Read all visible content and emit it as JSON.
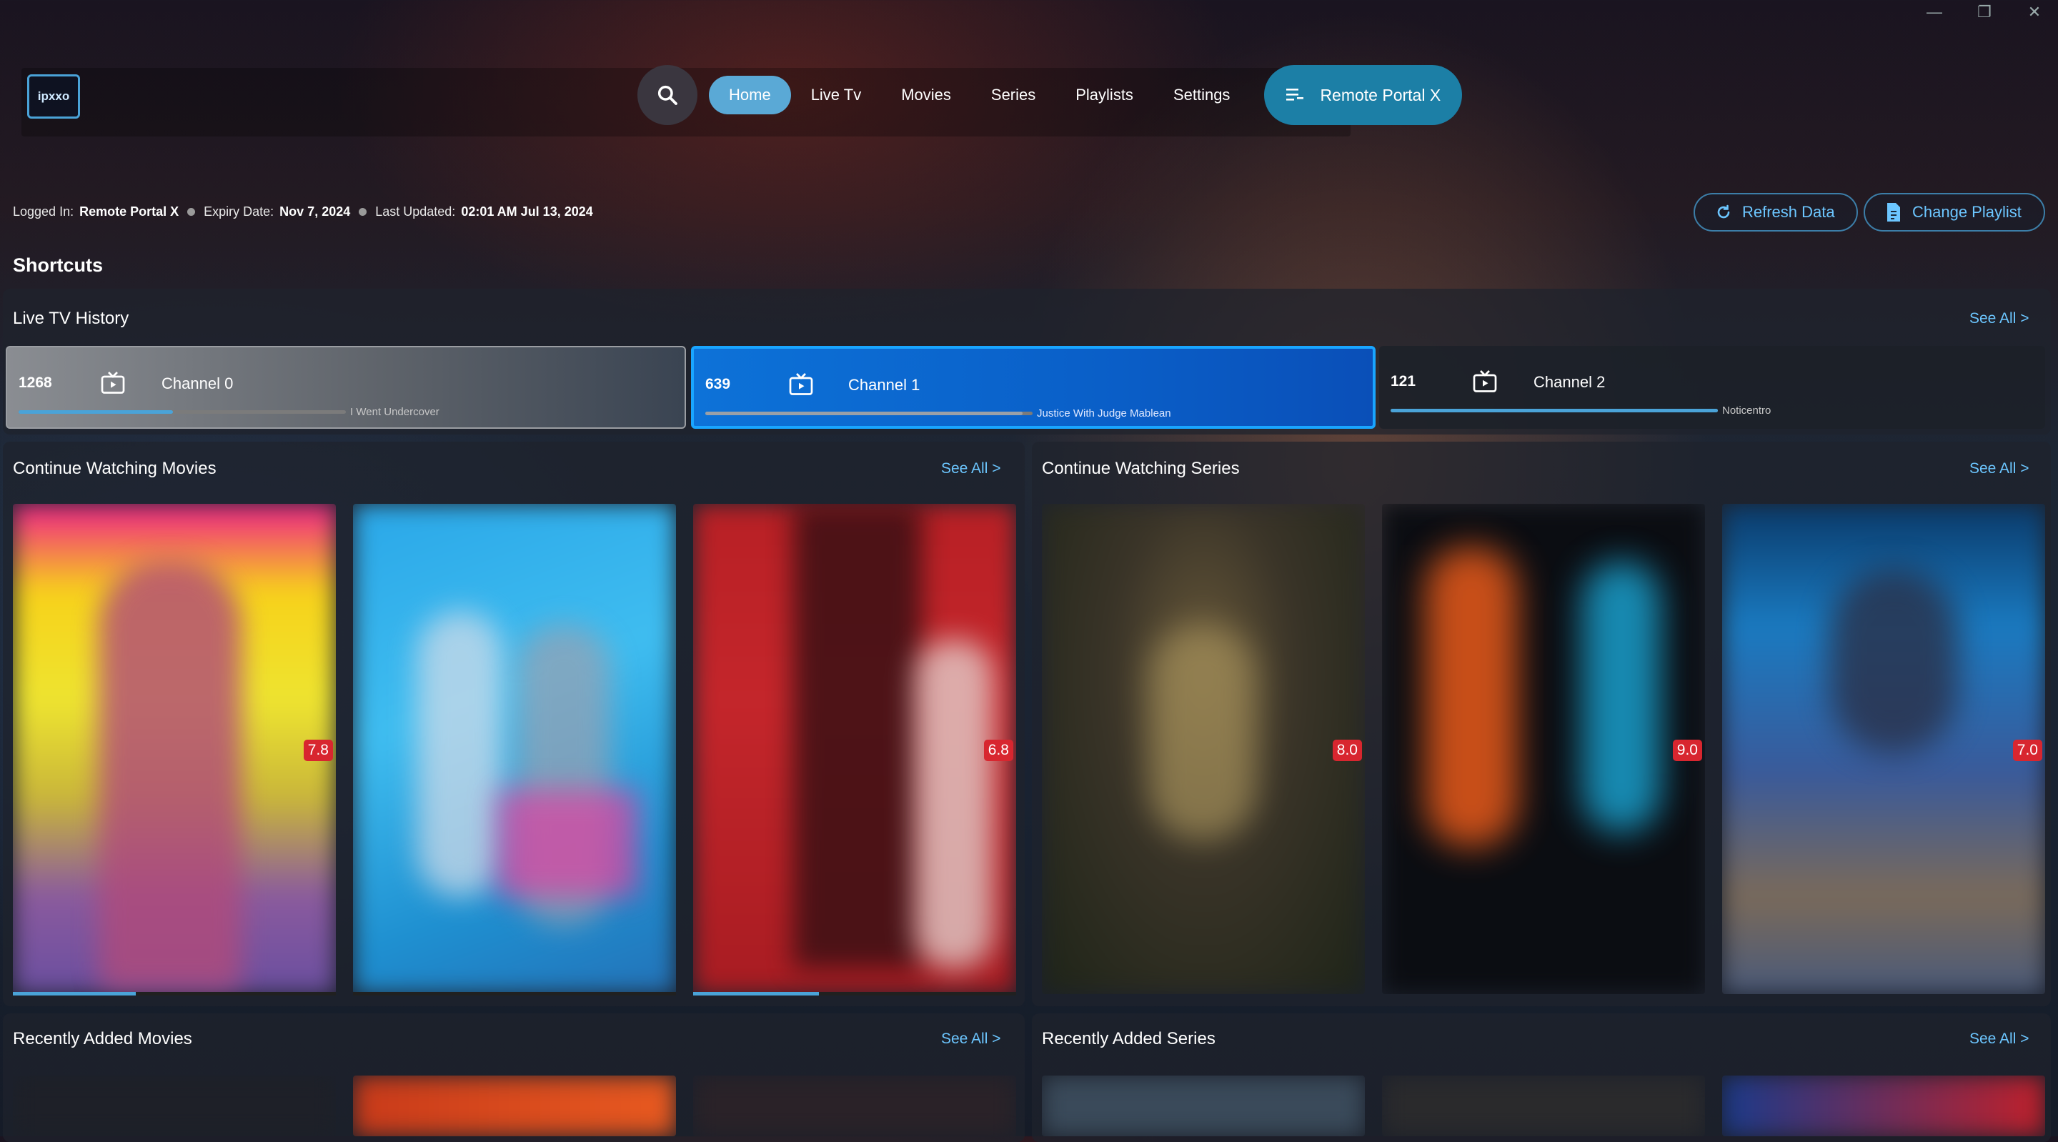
{
  "window": {
    "minimize": "—",
    "maximize": "❐",
    "close": "✕"
  },
  "logo": {
    "text": "ipxxo"
  },
  "nav": {
    "items": [
      "Home",
      "Live Tv",
      "Movies",
      "Series",
      "Playlists",
      "Settings"
    ],
    "active": "Home",
    "portal_label": "Remote Portal X"
  },
  "status": {
    "logged_in_label": "Logged In:",
    "logged_in_value": "Remote Portal X",
    "expiry_label": "Expiry Date:",
    "expiry_value": "Nov 7, 2024",
    "updated_label": "Last Updated:",
    "updated_value": "02:01 AM Jul 13, 2024"
  },
  "actions": {
    "refresh": "Refresh Data",
    "change_playlist": "Change Playlist"
  },
  "shortcuts_title": "Shortcuts",
  "see_all": "See All >",
  "live_tv_history": {
    "title": "Live TV History",
    "channels": [
      {
        "number": "1268",
        "name": "Channel 0",
        "program": "I Went Undercover",
        "progress": 0.47
      },
      {
        "number": "639",
        "name": "Channel 1",
        "program": "Justice With Judge Mablean",
        "progress": 0.97
      },
      {
        "number": "121",
        "name": "Channel 2",
        "program": "Noticentro",
        "progress": 1.0
      }
    ]
  },
  "continue_movies": {
    "title": "Continue Watching Movies",
    "items": [
      {
        "rating": "7.8",
        "progress": 0.38
      },
      {
        "rating": "",
        "progress": 0
      },
      {
        "rating": "6.8",
        "progress": 0.39
      }
    ]
  },
  "continue_series": {
    "title": "Continue Watching Series",
    "items": [
      {
        "rating": "8.0"
      },
      {
        "rating": "9.0"
      },
      {
        "rating": "7.0"
      }
    ]
  },
  "recent_movies": {
    "title": "Recently Added Movies"
  },
  "recent_series": {
    "title": "Recently Added Series"
  },
  "colors": {
    "accent": "#4aa3d8",
    "active_card": "#0a5fc8",
    "rating": "#d8262f",
    "link": "#6cc6ff"
  }
}
